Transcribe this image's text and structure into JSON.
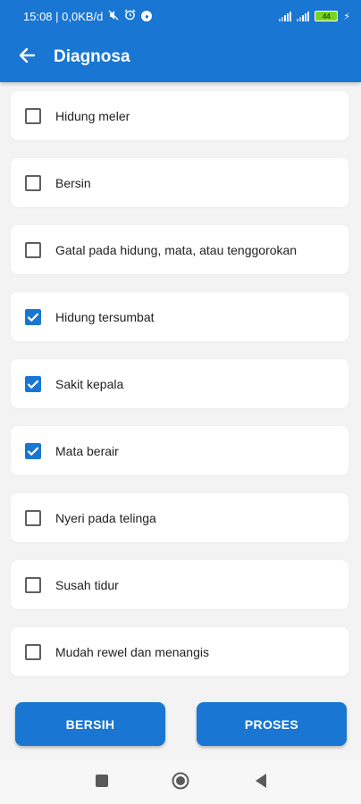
{
  "status_bar": {
    "time_info": "15:08 | 0,0KB/d",
    "battery": "44",
    "icons": [
      "mute-icon",
      "alarm-icon",
      "notification-icon",
      "signal-icon",
      "signal-icon",
      "battery-icon",
      "charging-icon"
    ]
  },
  "app_bar": {
    "title": "Diagnosa",
    "back_icon": "arrow-back-icon"
  },
  "symptoms": [
    {
      "label": "Hidung meler",
      "checked": false
    },
    {
      "label": "Bersin",
      "checked": false
    },
    {
      "label": "Gatal pada hidung, mata, atau tenggorokan",
      "checked": false
    },
    {
      "label": "Hidung tersumbat",
      "checked": true
    },
    {
      "label": "Sakit kepala",
      "checked": true
    },
    {
      "label": "Mata berair",
      "checked": true
    },
    {
      "label": "Nyeri pada telinga",
      "checked": false
    },
    {
      "label": "Susah tidur",
      "checked": false
    },
    {
      "label": "Mudah rewel dan menangis",
      "checked": false
    }
  ],
  "buttons": {
    "clear_label": "BERSIH",
    "process_label": "PROSES"
  },
  "nav": {
    "icons": [
      "recents-icon",
      "home-icon",
      "back-icon"
    ]
  },
  "colors": {
    "primary": "#1976d2",
    "background": "#f3f3f3",
    "card": "#ffffff"
  }
}
